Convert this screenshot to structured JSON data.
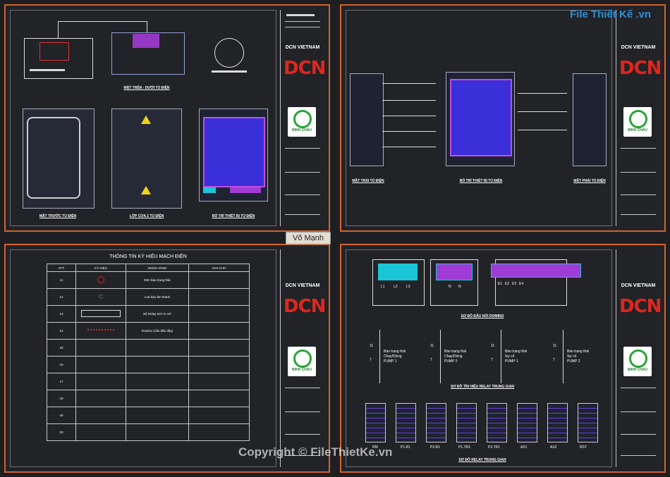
{
  "title_block": {
    "company": "DCN VIETNAM",
    "logo": "DCN",
    "partner": "BINH CHAU"
  },
  "sheet1": {
    "captions": [
      "MẶT TRÊN - DƯỚI TỦ ĐIỆN",
      "MẶT TRƯỚC TỦ ĐIỆN",
      "LỚP CỬA 2 TỦ ĐIỆN",
      "BỐ TRÍ THIẾT BỊ TỦ ĐIỆN"
    ]
  },
  "sheet2": {
    "captions": [
      "MẶT TRÁI TỦ ĐIỆN",
      "BỐ TRÍ THIẾT BỊ TỦ ĐIỆN",
      "MẶT PHẢI TỦ ĐIỆN"
    ]
  },
  "sheet3": {
    "title": "THÔNG TIN KÝ HIỆU MẠCH ĐIỆN",
    "headers": [
      "STT",
      "KÝ HIỆU",
      "NHÃN HÀNG",
      "GHI CHÚ"
    ],
    "rows": [
      {
        "stt": "11",
        "name": "Đèn báo trạng thái"
      },
      {
        "stt": "12",
        "name": "Loa báo âm thanh"
      },
      {
        "stt": "13",
        "name": "Bộ Relay 61F-G-AP"
      },
      {
        "stt": "14",
        "name": "Domino (cầu đấu dây)"
      },
      {
        "stt": "15",
        "name": ""
      },
      {
        "stt": "16",
        "name": ""
      },
      {
        "stt": "17",
        "name": ""
      },
      {
        "stt": "18",
        "name": ""
      },
      {
        "stt": "19",
        "name": ""
      },
      {
        "stt": "20",
        "name": ""
      }
    ]
  },
  "sheet4": {
    "captions": [
      "SƠ ĐỒ ĐẤU NỐI DOMINO",
      "SƠ ĐỒ TÍN HIỆU RELAY TRUNG GIAN",
      "SƠ ĐỒ RELAY TRUNG GIAN"
    ],
    "domino_labels": [
      "L1",
      "L2",
      "L3"
    ],
    "domino_labels2": [
      "N",
      "N"
    ],
    "domino_labels3": [
      "E1",
      "E2",
      "E3",
      "E4"
    ],
    "relay_texts": [
      [
        "Báo trạng thái",
        "Chạy/Dừng",
        "PUMP 1"
      ],
      [
        "Báo trạng thái",
        "Chạy/Dừng",
        "PUMP 2"
      ],
      [
        "Báo trạng thái",
        "Sự cố",
        "PUMP 1"
      ],
      [
        "Báo trạng thái",
        "Sự cố",
        "PUMP 2"
      ]
    ],
    "relay_nums": [
      "11",
      "7"
    ],
    "relay_names": [
      "RM",
      "P1.R1",
      "P2.R1",
      "P1.TR1",
      "P2.TR1",
      "AX1",
      "AX2",
      "RST"
    ]
  },
  "author": "Võ Mạnh",
  "brand": "File Thiết Kế .vn",
  "watermark": "Copyright © FileThietKe.vn"
}
